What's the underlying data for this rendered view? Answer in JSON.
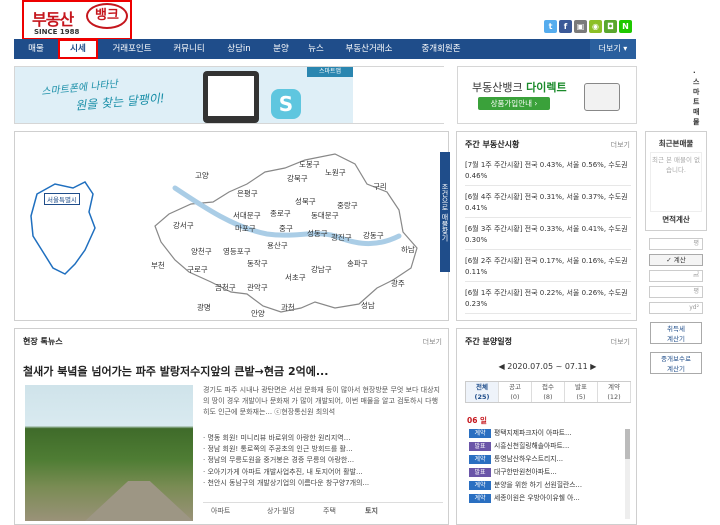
{
  "logo": {
    "name_part1": "부동산",
    "name_part2": "뱅크",
    "since": "SINCE 1988"
  },
  "social_icons": [
    {
      "icon": "twitter-icon",
      "glyph": "t",
      "color": "#55acee"
    },
    {
      "icon": "facebook-icon",
      "glyph": "f",
      "color": "#3b5998"
    },
    {
      "icon": "share-icon",
      "glyph": "▣",
      "color": "#7a7a7a"
    },
    {
      "icon": "android-icon",
      "glyph": "◉",
      "color": "#8cbf26"
    },
    {
      "icon": "me2day-icon",
      "glyph": "◘",
      "color": "#5aa72e"
    },
    {
      "icon": "naver-icon",
      "glyph": "N",
      "color": "#1ec800"
    }
  ],
  "nav": {
    "items": [
      "매물",
      "시세",
      "거래포인트",
      "커뮤니티",
      "상담in",
      "분양",
      "뉴스",
      "부동산거래소",
      "중개회원존"
    ],
    "active_index": 1,
    "more": "더보기 ▾"
  },
  "banner_app": {
    "script_line1": "스마트폰에 나타난",
    "script_line2": "원을 찾는 달팽이!",
    "icon_letter": "S",
    "app_label": "스마트앱",
    "smart_label": "· 스마트매물"
  },
  "banner_direct": {
    "title_a": "부동산뱅크 ",
    "title_b": "다이렉트",
    "button": "상품가입안내 ›"
  },
  "map": {
    "region_label": "서울특별시",
    "side_tab": "조건으로 매물찾기",
    "districts": [
      "도봉구",
      "노원구",
      "강북구",
      "고양",
      "은평구",
      "성북구",
      "중랑구",
      "구리",
      "서대문구",
      "종로구",
      "동대문구",
      "마포구",
      "중구",
      "성동구",
      "광진구",
      "강서구",
      "용산구",
      "양천구",
      "영등포구",
      "동작구",
      "강동구",
      "하남",
      "부천",
      "구로구",
      "강남구",
      "송파구",
      "서초구",
      "금천구",
      "관악구",
      "광명",
      "과천",
      "성남",
      "광주",
      "안양"
    ]
  },
  "market": {
    "title": "주간 부동산시황",
    "more": "더보기",
    "rows": [
      "[7월 1주 주간시황] 전국 0.43%, 서울 0.56%, 수도권 0.46%",
      "[6월 4주 주간시황] 전국 0.31%, 서울 0.37%, 수도권 0.41%",
      "[6월 3주 주간시황] 전국 0.33%, 서울 0.41%, 수도권 0.30%",
      "[6월 2주 주간시황] 전국 0.17%, 서울 0.16%, 수도권 0.11%",
      "[6월 1주 주간시황] 전국 0.22%, 서울 0.26%, 수도권 0.23%"
    ]
  },
  "recent": {
    "title": "최근본매물",
    "empty": "최근 본 매물이 없습니다."
  },
  "calc": {
    "title": "면적계산",
    "field1": "평",
    "btn": "✓ 계산",
    "field2": "㎡",
    "field3": "평",
    "field4": "yd²"
  },
  "side_buttons": [
    "취득세\n계산기",
    "중개보수료\n계산기"
  ],
  "news": {
    "title": "현장 톡뉴스",
    "more": "더보기",
    "headline": "철새가 북녘을 넘어가는 파주 발랑저수지앞의 큰밭→현금 2억에...",
    "summary": "경기도 파주 시내나 광탄면은 서선 문화재 등이 많아서 현장방문 무엇 보다 대상지의 땅이 경우 개발이나 문화재 가 많이 개발되어, 이번 매물을 알고 검토하시 다행히도 인근에 문화재는... ⓒ현장통신원 최의석",
    "bullets": [
      "· 명동 회원! 미니리뷰 바로위의 아랑한 원리지역...",
      "· 정남 회원! 통로쪽의 주공초의 인근 방회드를 활...",
      "· 정남의 무릉도원을 중거봉은 경증 무릉의 아랑한...",
      "· 오아기가게 아파트 개발사업추진, 내 토지어어 활발...",
      "· 천안시 동남구의 개발상기업의 이름다운 창구양7개의..."
    ],
    "tabs": [
      "아파트",
      "상가·빌딩",
      "주택",
      "토지"
    ]
  },
  "sale": {
    "title": "주간 분양일정",
    "more": "더보기",
    "range": "◀  2020.07.05 ~ 07.11  ▶",
    "days": [
      {
        "name": "전체",
        "count": "(25)"
      },
      {
        "name": "공고",
        "count": "(0)"
      },
      {
        "name": "접수",
        "count": "(8)"
      },
      {
        "name": "발표",
        "count": "(5)"
      },
      {
        "name": "계약",
        "count": "(12)"
      }
    ],
    "day_label": "06 일",
    "rows": [
      {
        "tag": "계약",
        "text": "평택지제파크자이 아파트...",
        "color": "#2a6fc1"
      },
      {
        "tag": "발표",
        "text": "시흥신천힐링해솔아파트...",
        "color": "#6a55a8"
      },
      {
        "tag": "계약",
        "text": "통영남산하우스트리지...",
        "color": "#2a6fc1"
      },
      {
        "tag": "발표",
        "text": "대구한만원천아파트...",
        "color": "#6a55a8"
      },
      {
        "tag": "계약",
        "text": "분양을 위한 하기 선원힐란스...",
        "color": "#2a6fc1"
      },
      {
        "tag": "계약",
        "text": "세종이원은 우방아이유쉘 아...",
        "color": "#2a6fc1"
      }
    ]
  }
}
